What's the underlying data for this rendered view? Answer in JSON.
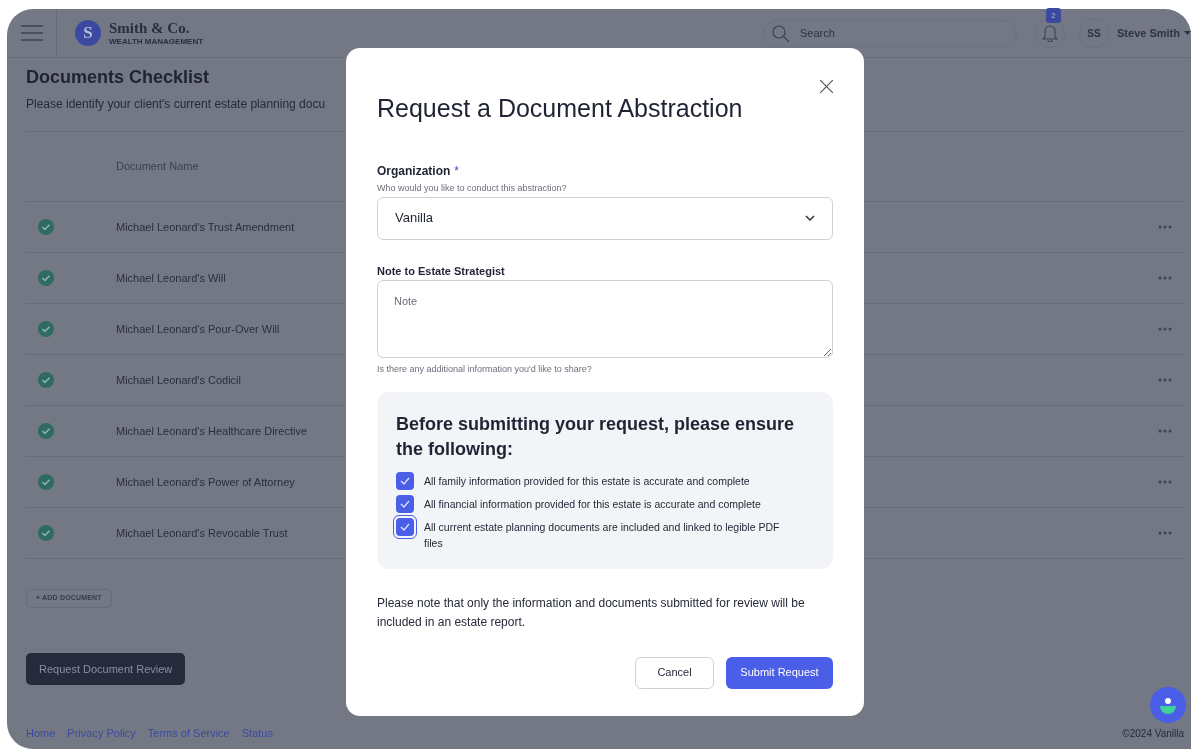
{
  "header": {
    "brand": "Smith & Co.",
    "brand_initial": "S",
    "brand_subtitle": "WEALTH MANAGEMENT",
    "search": {
      "placeholder": "Search"
    },
    "notifications": "2",
    "user_initials": "SS",
    "user_name": "Steve Smith"
  },
  "page": {
    "title": "Documents Checklist",
    "description": "Please identify your client's current estate planning docu",
    "table": {
      "columns": [
        "Document Name"
      ],
      "rows": [
        {
          "name": "Michael Leonard's Trust Amendment",
          "complete": true
        },
        {
          "name": "Michael Leonard's Will",
          "complete": true
        },
        {
          "name": "Michael Leonard's Pour-Over Will",
          "complete": true
        },
        {
          "name": "Michael Leonard's Codicil",
          "complete": true
        },
        {
          "name": "Michael Leonard's Healthcare Directive",
          "complete": true
        },
        {
          "name": "Michael Leonard's Power of Attorney",
          "complete": true
        },
        {
          "name": "Michael Leonard's Revocable Trust",
          "complete": true
        }
      ]
    },
    "add_button": "+ ADD DOCUMENT",
    "review_button": "Request Document Review"
  },
  "footer": {
    "links": [
      "Home",
      "Privacy Policy",
      "Terms of Service",
      "Status"
    ],
    "copyright": "©2024 Vanilla"
  },
  "modal": {
    "title": "Request a Document Abstraction",
    "organization": {
      "label": "Organization",
      "required_mark": "*",
      "hint": "Who would you like to conduct this abstraction?",
      "value": "Vanilla"
    },
    "note": {
      "label": "Note to Estate Strategist",
      "placeholder": "Note",
      "hint": "Is there any additional information you'd like to share?"
    },
    "confirm": {
      "heading": "Before submitting your request, please ensure the following:",
      "items": [
        {
          "label": "All family information provided for this estate is accurate and complete",
          "checked": true,
          "focused": false
        },
        {
          "label": "All financial information provided for this estate is accurate and complete",
          "checked": true,
          "focused": false
        },
        {
          "label": "All current estate planning documents are included and linked to legible PDF files",
          "checked": true,
          "focused": true
        }
      ]
    },
    "notice": "Please note that only the information and documents submitted for review will be included in an estate report.",
    "buttons": {
      "cancel": "Cancel",
      "submit": "Submit Request"
    }
  }
}
